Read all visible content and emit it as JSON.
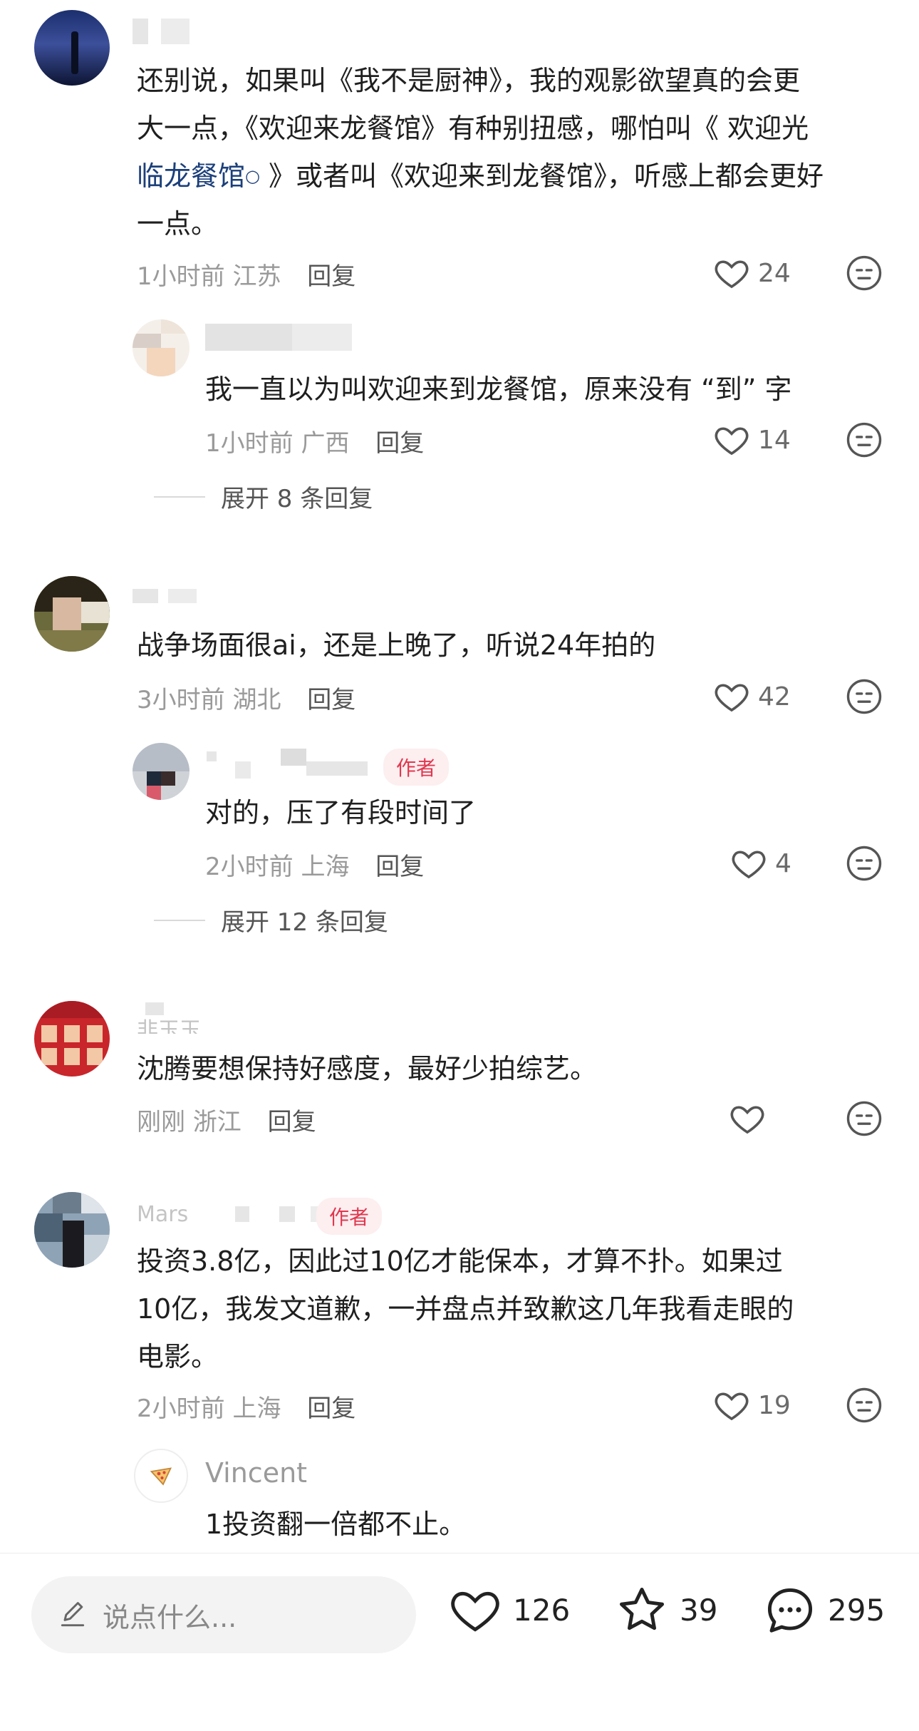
{
  "comments": [
    {
      "name_partial": "",
      "content_lines": [
        "还别说，如果叫《我不是厨神》，我的观影欲望真的会更",
        "大一点，《欢迎来龙餐馆》有种别扭感，哪怕叫《 欢迎光",
        "临龙餐馆",
        " 》或者叫《欢迎来到龙餐馆》，听感上都会更好",
        "一点。"
      ],
      "link_text_1": "欢迎光",
      "link_text_2": "临龙餐馆",
      "time": "1小时前",
      "location": "江苏",
      "reply_label": "回复",
      "likes": "24",
      "replies": [
        {
          "content": "我一直以为叫欢迎来到龙餐馆，原来没有 “到” 字",
          "time": "1小时前",
          "location": "广西",
          "reply_label": "回复",
          "likes": "14"
        }
      ],
      "expand_label": "展开 8 条回复"
    },
    {
      "content": "战争场面很ai，还是上晚了，听说24年拍的",
      "time": "3小时前",
      "location": "湖北",
      "reply_label": "回复",
      "likes": "42",
      "replies": [
        {
          "badge": "作者",
          "content": "对的，压了有段时间了",
          "time": "2小时前",
          "location": "上海",
          "reply_label": "回复",
          "likes": "4"
        }
      ],
      "expand_label": "展开 12 条回复"
    },
    {
      "name_partial": "非玉玉",
      "content": "沈腾要想保持好感度，最好少拍综艺。",
      "time": "刚刚",
      "location": "浙江",
      "reply_label": "回复"
    },
    {
      "name_partial": "Mars",
      "badge": "作者",
      "content_lines": [
        "投资3.8亿，因此过10亿才能保本，才算不扑。如果过",
        "10亿，我发文道歉，一并盘点并致歉这几年我看走眼的",
        "电影。"
      ],
      "time": "2小时前",
      "location": "上海",
      "reply_label": "回复",
      "likes": "19",
      "replies": [
        {
          "name": "Vincent",
          "content": "1投资翻一倍都不止。"
        }
      ]
    }
  ],
  "bottom_bar": {
    "input_placeholder": "说点什么...",
    "likes": "126",
    "favorites": "39",
    "comments": "295"
  },
  "colors": {
    "accent_red": "#e0384f",
    "link_blue": "#1b3f7a",
    "meta_gray": "#9a9a9a"
  }
}
